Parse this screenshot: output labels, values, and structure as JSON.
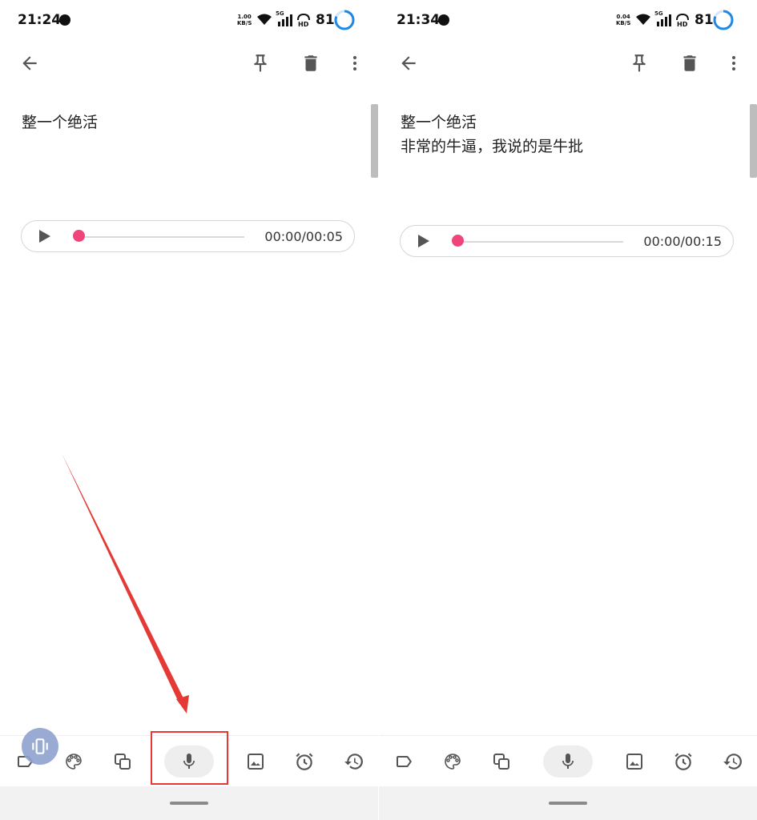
{
  "left": {
    "status": {
      "time": "21:24",
      "speed_value": "1.00",
      "speed_unit": "KB/S",
      "network": "5G",
      "battery": "81"
    },
    "note": {
      "line1": "整一个绝活",
      "line2": ""
    },
    "player": {
      "time": "00:00/00:05"
    }
  },
  "right": {
    "status": {
      "time": "21:34",
      "speed_value": "0.04",
      "speed_unit": "KB/S",
      "network": "5G",
      "battery": "81"
    },
    "note": {
      "line1": "整一个绝活",
      "line2": "非常的牛逼，我说的是牛批"
    },
    "player": {
      "time": "00:00/00:15"
    }
  },
  "colors": {
    "accent": "#f0447a",
    "annotation": "#e53935",
    "battery_ring": "#1e88e5",
    "mic_pill": "#eeeeee"
  },
  "icons": {
    "top_bar": [
      "back-arrow-icon",
      "pin-icon",
      "trash-icon",
      "more-vert-icon"
    ],
    "bottom_bar": [
      "label-icon",
      "palette-icon",
      "copy-icon",
      "mic-icon",
      "image-icon",
      "alarm-icon",
      "history-icon"
    ]
  }
}
